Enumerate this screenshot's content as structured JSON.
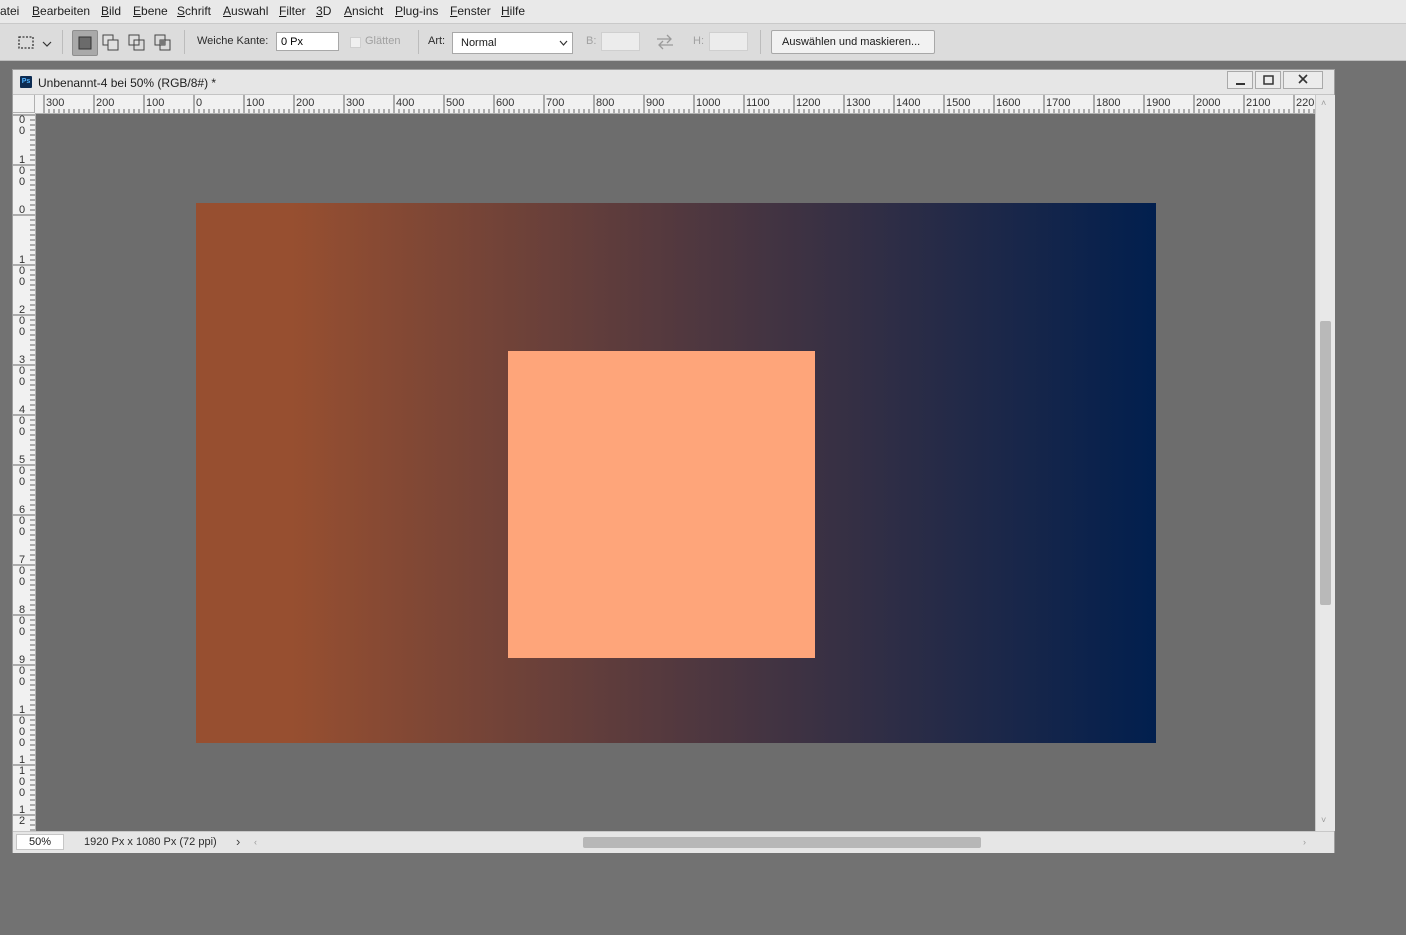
{
  "menu": {
    "items": [
      "atei",
      "Bearbeiten",
      "Bild",
      "Ebene",
      "Schrift",
      "Auswahl",
      "Filter",
      "3D",
      "Ansicht",
      "Plug-ins",
      "Fenster",
      "Hilfe"
    ]
  },
  "options": {
    "feather_label": "Weiche Kante:",
    "feather_value": "0 Px",
    "antialias_label": "Glätten",
    "style_label": "Art:",
    "style_value": "Normal",
    "width_label": "B:",
    "height_label": "H:",
    "select_mask_label": "Auswählen und maskieren..."
  },
  "document": {
    "title": "Unbenannt-4 bei 50% (RGB/8#) *",
    "zoom": "50%",
    "info": "1920 Px x 1080 Px (72 ppi)",
    "ruler_h": [
      "300",
      "200",
      "100",
      "0",
      "100",
      "200",
      "300",
      "400",
      "500",
      "600",
      "700",
      "800",
      "900",
      "1000",
      "1100",
      "1200",
      "1300",
      "1400",
      "1500",
      "1600",
      "1700",
      "1800",
      "1900",
      "2000",
      "2100",
      "220"
    ],
    "ruler_v": [
      "00",
      "100",
      "0",
      "100",
      "200",
      "300",
      "400",
      "500",
      "600",
      "700",
      "800",
      "900",
      "1000",
      "1100",
      "12"
    ]
  },
  "canvas": {
    "gradient_start": "#974f30",
    "gradient_mid": "#51383f",
    "gradient_end": "#011f4e",
    "square_color": "#fea57a",
    "pasteboard": "#6d6d6d"
  }
}
